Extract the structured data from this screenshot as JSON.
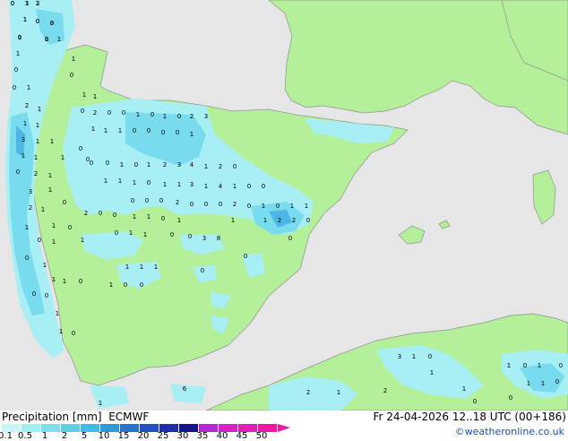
{
  "title": {
    "product": "Precipitation [mm]",
    "model": "ECMWF",
    "valid_time": "Fr 24-04-2026 12..18 UTC (00+186)"
  },
  "credit": "©weatheronline.co.uk",
  "legend": {
    "ticks": [
      "0.1",
      "0.5",
      "1",
      "2",
      "5",
      "10",
      "15",
      "20",
      "25",
      "30",
      "35",
      "40",
      "45",
      "50"
    ],
    "colors": [
      "#c8f5f8",
      "#a2eef3",
      "#7fe0ec",
      "#5fd0e6",
      "#40bce0",
      "#2f98d6",
      "#2a72cc",
      "#2650c0",
      "#1f2ea8",
      "#14148a",
      "#b428d6",
      "#d424c8",
      "#e020b0",
      "#ec1aa0"
    ]
  },
  "colors": {
    "land": "#b4f09a",
    "sea": "#e6e6e6",
    "border": "#909090",
    "rain_light": "#a8eef5",
    "rain_mid": "#78dcee",
    "rain_heavy": "#4cb6e6"
  },
  "map_values": [
    {
      "t": "0"
    },
    {
      "t": "3"
    },
    {
      "t": "3"
    },
    {
      "t": "1"
    },
    {
      "t": "0"
    },
    {
      "t": "3"
    },
    {
      "t": "0"
    },
    {
      "t": "0"
    },
    {
      "t": "1"
    },
    {
      "t": "1"
    },
    {
      "t": "1"
    },
    {
      "t": "0"
    },
    {
      "t": "0"
    },
    {
      "t": "0"
    },
    {
      "t": "1"
    },
    {
      "t": "1"
    },
    {
      "t": "2"
    },
    {
      "t": "1"
    },
    {
      "t": "1"
    },
    {
      "t": "1"
    },
    {
      "t": "1"
    },
    {
      "t": "3"
    },
    {
      "t": "1"
    },
    {
      "t": "1"
    },
    {
      "t": "0"
    },
    {
      "t": "2"
    },
    {
      "t": "0"
    },
    {
      "t": "0"
    },
    {
      "t": "1"
    },
    {
      "t": "1"
    },
    {
      "t": "0"
    },
    {
      "t": "2"
    },
    {
      "t": "1"
    },
    {
      "t": "1"
    },
    {
      "t": "0"
    },
    {
      "t": "0"
    },
    {
      "t": "1"
    },
    {
      "t": "0"
    },
    {
      "t": "1"
    },
    {
      "t": "0"
    },
    {
      "t": "2"
    },
    {
      "t": "3"
    },
    {
      "t": "1"
    },
    {
      "t": "1"
    },
    {
      "t": "1"
    },
    {
      "t": "0"
    },
    {
      "t": "0"
    },
    {
      "t": "0"
    },
    {
      "t": "0"
    },
    {
      "t": "1"
    },
    {
      "t": "0"
    },
    {
      "t": "0"
    },
    {
      "t": "1"
    },
    {
      "t": "0"
    },
    {
      "t": "1"
    },
    {
      "t": "2"
    },
    {
      "t": "3"
    },
    {
      "t": "4"
    },
    {
      "t": "1"
    },
    {
      "t": "2"
    },
    {
      "t": "0"
    },
    {
      "t": "1"
    },
    {
      "t": "1"
    },
    {
      "t": "1"
    },
    {
      "t": "0"
    },
    {
      "t": "1"
    },
    {
      "t": "1"
    },
    {
      "t": "3"
    },
    {
      "t": "1"
    },
    {
      "t": "4"
    },
    {
      "t": "1"
    },
    {
      "t": "0"
    },
    {
      "t": "0"
    },
    {
      "t": "1"
    },
    {
      "t": "3"
    },
    {
      "t": "0"
    },
    {
      "t": "2"
    },
    {
      "t": "1"
    },
    {
      "t": "1"
    },
    {
      "t": "2"
    },
    {
      "t": "0"
    },
    {
      "t": "0"
    },
    {
      "t": "0"
    },
    {
      "t": "0"
    },
    {
      "t": "0"
    },
    {
      "t": "2"
    },
    {
      "t": "0"
    },
    {
      "t": "0"
    },
    {
      "t": "0"
    },
    {
      "t": "2"
    },
    {
      "t": "0"
    },
    {
      "t": "1"
    },
    {
      "t": "0"
    },
    {
      "t": "1"
    },
    {
      "t": "1"
    },
    {
      "t": "1"
    },
    {
      "t": "1"
    },
    {
      "t": "0"
    },
    {
      "t": "1"
    },
    {
      "t": "1"
    },
    {
      "t": "1"
    },
    {
      "t": "2"
    },
    {
      "t": "2"
    },
    {
      "t": "0"
    },
    {
      "t": "0"
    },
    {
      "t": "0"
    },
    {
      "t": "1"
    },
    {
      "t": "1"
    },
    {
      "t": "0"
    },
    {
      "t": "1"
    },
    {
      "t": "0"
    },
    {
      "t": "1"
    },
    {
      "t": "1"
    },
    {
      "t": "0"
    },
    {
      "t": "0"
    },
    {
      "t": "3"
    },
    {
      "t": "8"
    },
    {
      "t": "0"
    },
    {
      "t": "0"
    },
    {
      "t": "1"
    },
    {
      "t": "1"
    },
    {
      "t": "1"
    },
    {
      "t": "0"
    },
    {
      "t": "1"
    },
    {
      "t": "1"
    },
    {
      "t": "1"
    },
    {
      "t": "1"
    },
    {
      "t": "0"
    },
    {
      "t": "0"
    },
    {
      "t": "0"
    },
    {
      "t": "0"
    },
    {
      "t": "0"
    },
    {
      "t": "1"
    },
    {
      "t": "1"
    },
    {
      "t": "0"
    },
    {
      "t": "3"
    },
    {
      "t": "1"
    },
    {
      "t": "0"
    },
    {
      "t": "1"
    },
    {
      "t": "0"
    },
    {
      "t": "1"
    },
    {
      "t": "1"
    },
    {
      "t": "1"
    },
    {
      "t": "0"
    },
    {
      "t": "0"
    },
    {
      "t": "1"
    },
    {
      "t": "1"
    },
    {
      "t": "0"
    },
    {
      "t": "1"
    },
    {
      "t": "2"
    },
    {
      "t": "2"
    },
    {
      "t": "6"
    },
    {
      "t": "1"
    },
    {
      "t": "0"
    },
    {
      "t": "0"
    },
    {
      "t": "1"
    },
    {
      "t": "2"
    },
    {
      "t": "1"
    },
    {
      "t": "0"
    },
    {
      "t": "0"
    },
    {
      "t": "1"
    },
    {
      "t": "1"
    }
  ]
}
